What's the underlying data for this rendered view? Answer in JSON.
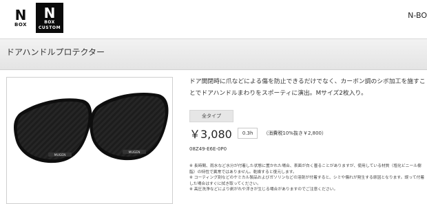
{
  "header": {
    "logo_nbox": {
      "line1": "N",
      "line2": "BOX"
    },
    "logo_custom": {
      "line1": "N",
      "line2": "BOX",
      "line3": "CUSTOM"
    },
    "nav_text": "N-BO"
  },
  "page": {
    "title": "ドアハンドルプロテクター"
  },
  "product": {
    "description": "ドア開閉時に爪などによる傷を防止できるだけでなく、カーボン調のシボ加工を施すことでドアハンドルまわりをスポーティに演出。Mサイズ2枚入り。",
    "type_label": "全タイプ",
    "price": "￥3,080",
    "hours": "0.3h",
    "tax_note": "（消費税10%抜き￥2,800）",
    "part_number": "08Z49-E6E-0P0",
    "notes": [
      "※ 長時間、雨水など水分が付着した状態に置かれた場合、表面が白く曇ることがありますが、使用している材質（塩化ビニール樹脂）の特性で異常ではありません。乾燥すると復元します。",
      "※ コーティング剤などのケミカル製品およびガソリンなどの溶剤が付着すると、シミや傷れが発生する原因となります。誤って付着した場合はすぐに拭き取ってください。",
      "※ 高圧洗浄などにより剥がれや浮きが生じる場合がありますのでご注意ください。"
    ],
    "brand_mark": "MUGEN"
  },
  "colors": {
    "title_bar": "#e8e8e8",
    "logo_dark": "#0a0a0a",
    "protector": "#1b1b1b"
  }
}
